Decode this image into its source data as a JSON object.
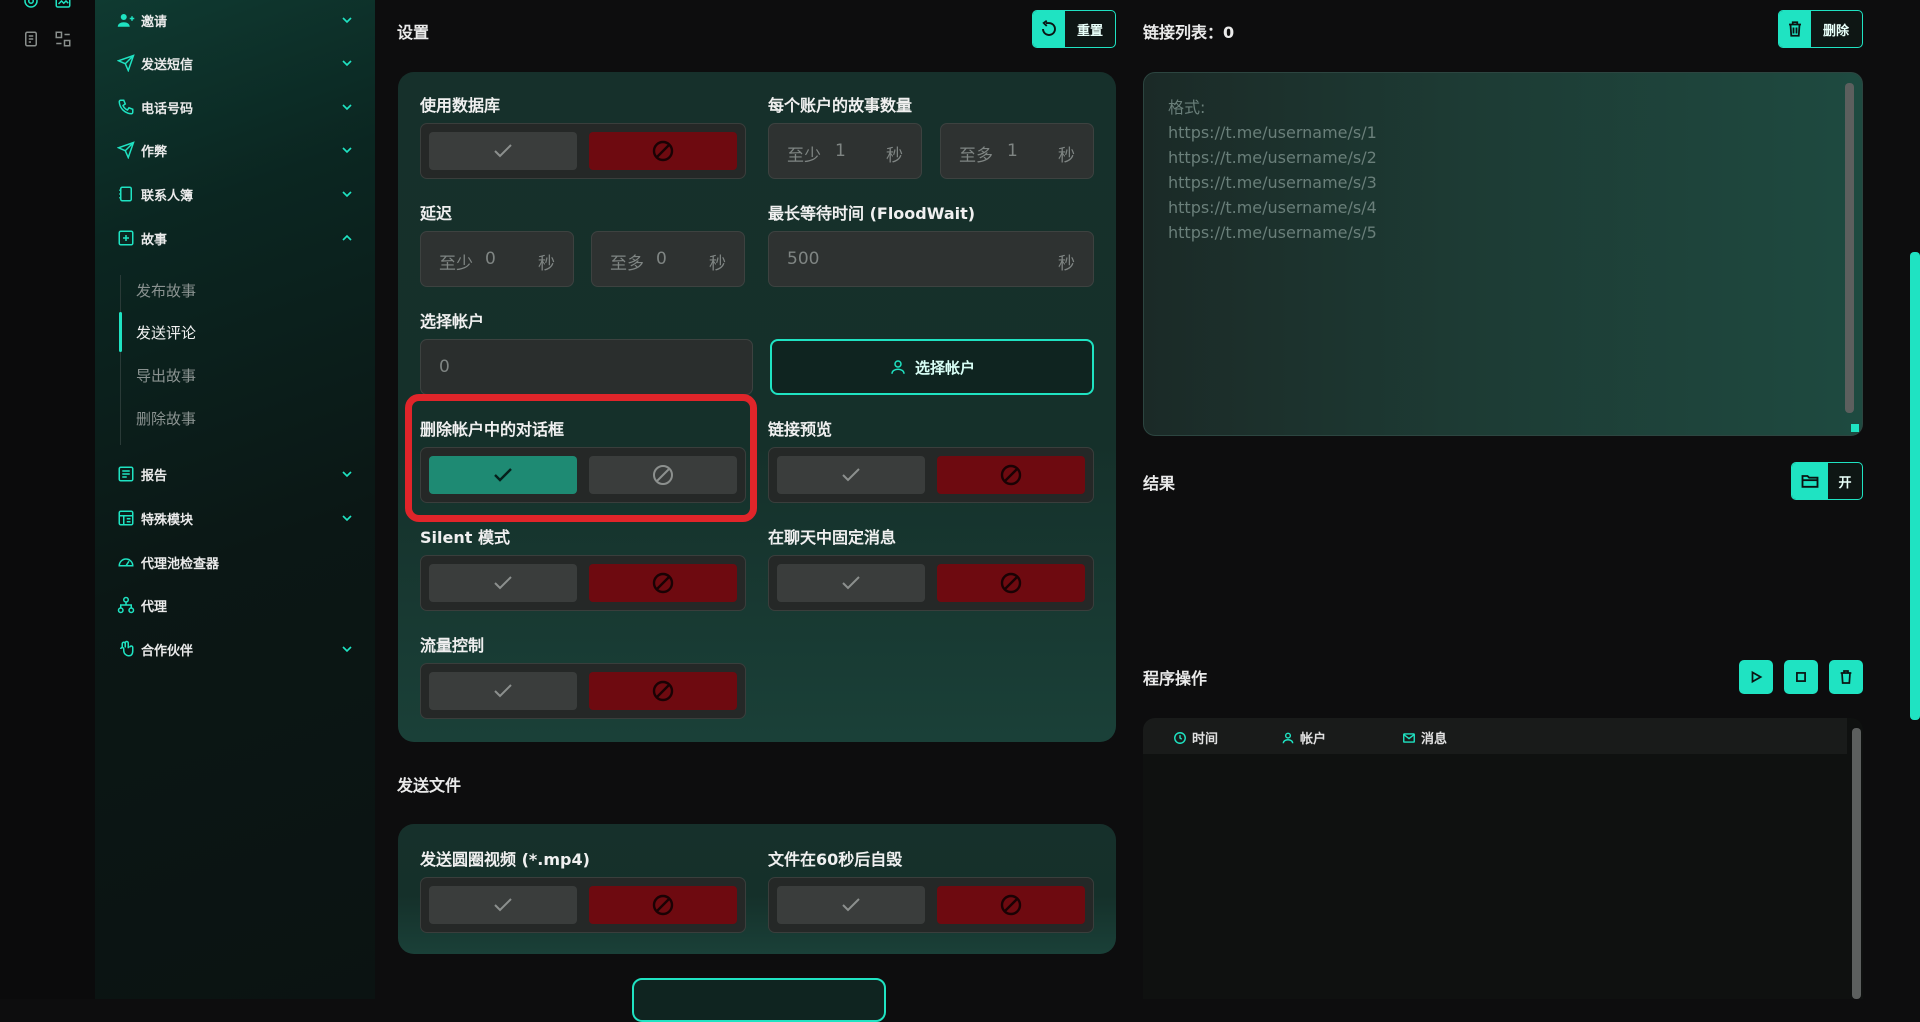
{
  "sidebar": {
    "items": [
      {
        "label": "邀请",
        "icon": "users-icon"
      },
      {
        "label": "发送短信",
        "icon": "send-icon"
      },
      {
        "label": "电话号码",
        "icon": "phone-icon"
      },
      {
        "label": "作弊",
        "icon": "send-icon"
      },
      {
        "label": "联系人簿",
        "icon": "contacts-icon"
      },
      {
        "label": "故事",
        "icon": "plus-square-icon"
      },
      {
        "label": "报告",
        "icon": "report-icon"
      },
      {
        "label": "特殊模块",
        "icon": "module-icon"
      },
      {
        "label": "代理池检查器",
        "icon": "gauge-icon"
      },
      {
        "label": "代理",
        "icon": "network-icon"
      },
      {
        "label": "合作伙伴",
        "icon": "hand-icon"
      }
    ],
    "sub_items": [
      "发布故事",
      "发送评论",
      "导出故事",
      "删除故事"
    ],
    "active_sub": "发送评论"
  },
  "settings": {
    "title": "设置",
    "reset_label": "重置",
    "use_db_label": "使用数据库",
    "stories_per_account_label": "每个账户的故事数量",
    "delay_label": "延迟",
    "floodwait_label": "最长等待时间 (FloodWait)",
    "select_account_label": "选择帐户",
    "select_account_button": "选择帐户",
    "delete_dialog_label": "删除帐户中的对话框",
    "link_preview_label": "链接预览",
    "silent_label": "Silent 模式",
    "pin_label": "在聊天中固定消息",
    "flow_label": "流量控制",
    "min_prefix": "至少",
    "max_prefix": "至多",
    "stories_min": "1",
    "stories_max": "1",
    "delay_min": "0",
    "delay_max": "0",
    "floodwait_value": "500",
    "account_value": "0",
    "sec_unit": "秒"
  },
  "send_files": {
    "title": "发送文件",
    "circle_video_label": "发送圆圈视频 (*.mp4)",
    "self_destruct_label": "文件在60秒后自毁"
  },
  "links": {
    "title": "链接列表：0",
    "delete_label": "删除",
    "placeholder_lines": [
      "格式:",
      "https://t.me/username/s/1",
      "https://t.me/username/s/2",
      "https://t.me/username/s/3",
      "https://t.me/username/s/4",
      "https://t.me/username/s/5"
    ]
  },
  "results": {
    "title": "结果",
    "open_label": "开"
  },
  "program": {
    "title": "程序操作",
    "col_time": "时间",
    "col_account": "帐户",
    "col_message": "消息"
  },
  "colors": {
    "accent": "#1fe3c2",
    "danger": "#6e0a10",
    "on": "#1e8a73",
    "highlight": "#e0252a"
  }
}
